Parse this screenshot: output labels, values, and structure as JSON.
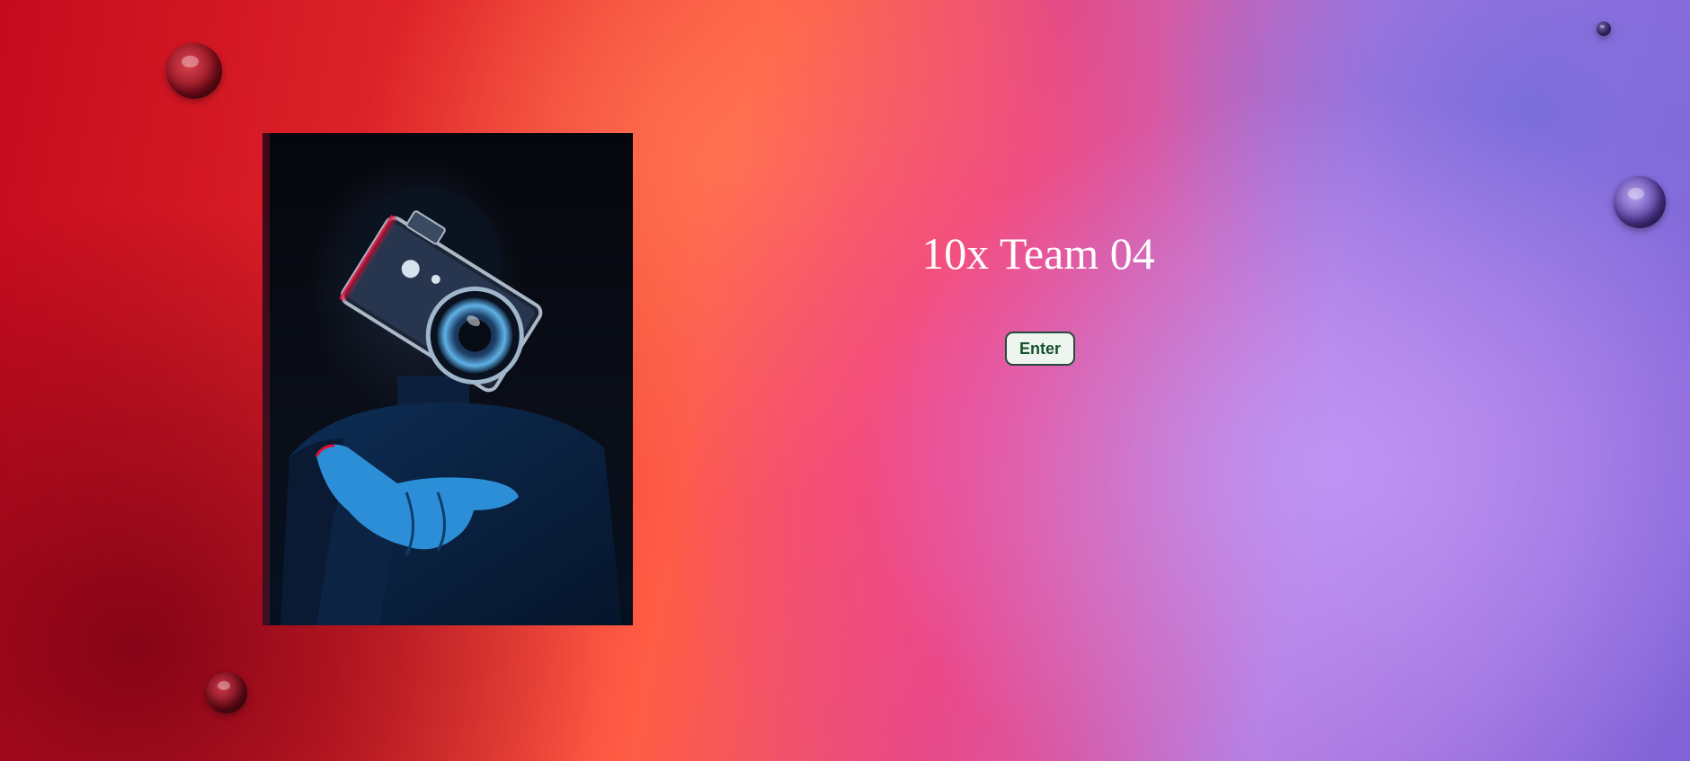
{
  "page": {
    "title": "10x Team 04",
    "enter_label": "Enter"
  },
  "hero_image": {
    "subject": "person with floating camera above open hand",
    "colors": {
      "background": "#05070d",
      "accent_blue": "#1a8fd6",
      "accent_red": "#d0103a"
    }
  },
  "background": {
    "colors": [
      "#c60a1e",
      "#ff5d45",
      "#e34a86",
      "#b57ae0",
      "#7f63d8"
    ]
  },
  "button_colors": {
    "fill": "#eef4ee",
    "border": "#244a3a",
    "text": "#14532d"
  }
}
